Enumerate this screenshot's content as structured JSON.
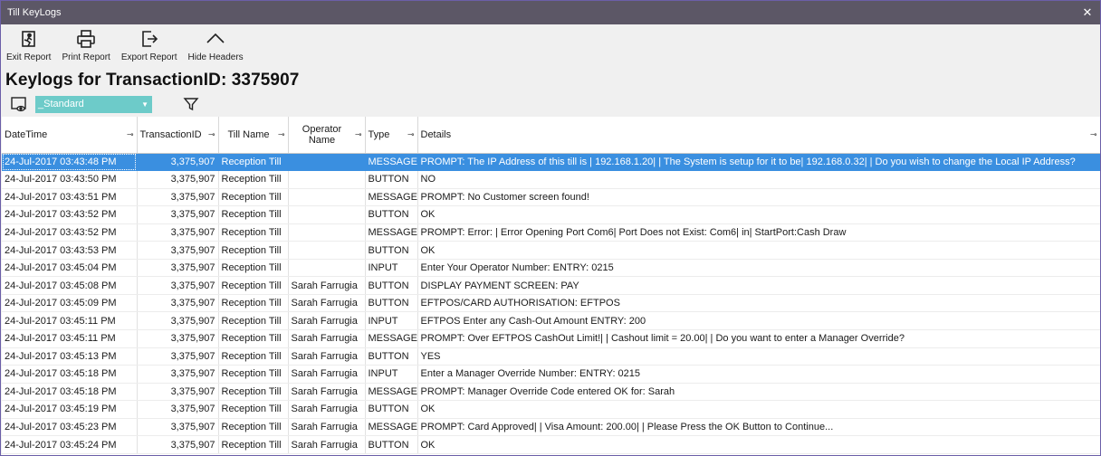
{
  "window": {
    "title": "Till KeyLogs",
    "close_glyph": "✕"
  },
  "toolbar": {
    "buttons": [
      {
        "label": "Exit Report",
        "icon": "exit-report-icon"
      },
      {
        "label": "Print Report",
        "icon": "printer-icon"
      },
      {
        "label": "Export Report",
        "icon": "export-icon"
      },
      {
        "label": "Hide Headers",
        "icon": "chevron-up-icon"
      }
    ]
  },
  "page_title": "Keylogs for TransactionID: 3375907",
  "view": {
    "layout_value": "_Standard"
  },
  "colors": {
    "accent": "#6dcbc9",
    "selection": "#3a8fe0",
    "titlebar": "#5c5766"
  },
  "table": {
    "columns": [
      "DateTime",
      "TransactionID",
      "Till Name",
      "Operator Name",
      "Type",
      "Details"
    ],
    "rows": [
      [
        "24-Jul-2017 03:43:48 PM",
        "3,375,907",
        "Reception Till",
        "",
        "MESSAGE",
        "PROMPT: The IP Address of this till is | 192.168.1.20| | The System is setup for it to be| 192.168.0.32| | Do you wish to change the Local IP Address?"
      ],
      [
        "24-Jul-2017 03:43:50 PM",
        "3,375,907",
        "Reception Till",
        "",
        "BUTTON",
        "NO"
      ],
      [
        "24-Jul-2017 03:43:51 PM",
        "3,375,907",
        "Reception Till",
        "",
        "MESSAGE",
        "PROMPT: No Customer screen found!"
      ],
      [
        "24-Jul-2017 03:43:52 PM",
        "3,375,907",
        "Reception Till",
        "",
        "BUTTON",
        "OK"
      ],
      [
        "24-Jul-2017 03:43:52 PM",
        "3,375,907",
        "Reception Till",
        "",
        "MESSAGE",
        "PROMPT: Error: | Error Opening Port Com6| Port Does not Exist: Com6| in| StartPort:Cash Draw"
      ],
      [
        "24-Jul-2017 03:43:53 PM",
        "3,375,907",
        "Reception Till",
        "",
        "BUTTON",
        "OK"
      ],
      [
        "24-Jul-2017 03:45:04 PM",
        "3,375,907",
        "Reception Till",
        "",
        "INPUT",
        "Enter Your Operator Number:     ENTRY: 0215"
      ],
      [
        "24-Jul-2017 03:45:08 PM",
        "3,375,907",
        "Reception Till",
        "Sarah  Farrugia",
        "BUTTON",
        "DISPLAY PAYMENT SCREEN:   PAY"
      ],
      [
        "24-Jul-2017 03:45:09 PM",
        "3,375,907",
        "Reception Till",
        "Sarah  Farrugia",
        "BUTTON",
        "EFTPOS/CARD AUTHORISATION:   EFTPOS"
      ],
      [
        "24-Jul-2017 03:45:11 PM",
        "3,375,907",
        "Reception Till",
        "Sarah  Farrugia",
        "INPUT",
        "EFTPOS Enter any Cash-Out Amount     ENTRY: 200"
      ],
      [
        "24-Jul-2017 03:45:11 PM",
        "3,375,907",
        "Reception Till",
        "Sarah  Farrugia",
        "MESSAGE",
        "PROMPT: Over EFTPOS CashOut Limit!| | Cashout limit = 20.00| | Do you want to enter a Manager Override?"
      ],
      [
        "24-Jul-2017 03:45:13 PM",
        "3,375,907",
        "Reception Till",
        "Sarah  Farrugia",
        "BUTTON",
        "YES"
      ],
      [
        "24-Jul-2017 03:45:18 PM",
        "3,375,907",
        "Reception Till",
        "Sarah  Farrugia",
        "INPUT",
        "Enter a Manager Override Number:     ENTRY: 0215"
      ],
      [
        "24-Jul-2017 03:45:18 PM",
        "3,375,907",
        "Reception Till",
        "Sarah  Farrugia",
        "MESSAGE",
        "PROMPT: Manager Override Code entered OK for: Sarah"
      ],
      [
        "24-Jul-2017 03:45:19 PM",
        "3,375,907",
        "Reception Till",
        "Sarah  Farrugia",
        "BUTTON",
        "OK"
      ],
      [
        "24-Jul-2017 03:45:23 PM",
        "3,375,907",
        "Reception Till",
        "Sarah  Farrugia",
        "MESSAGE",
        "PROMPT: Card Approved| | Visa  Amount: 200.00| | Please Press the OK Button to Continue..."
      ],
      [
        "24-Jul-2017 03:45:24 PM",
        "3,375,907",
        "Reception Till",
        "Sarah  Farrugia",
        "BUTTON",
        "OK"
      ]
    ],
    "selected_row": 0,
    "pin_glyph": "⊸"
  }
}
